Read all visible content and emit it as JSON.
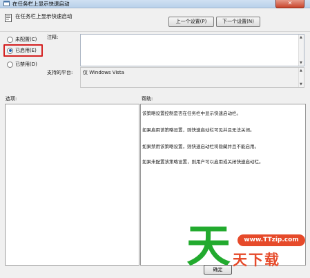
{
  "window": {
    "title": "在任务栏上显示快速启动"
  },
  "header": {
    "policy_name": "在任务栏上显示快速启动",
    "prev_label": "上一个设置(P)",
    "next_label": "下一个设置(N)"
  },
  "state": {
    "unconfigured": "未配置(C)",
    "enabled": "已启用(E)",
    "disabled": "已禁用(D)",
    "selected": "enabled"
  },
  "comment": {
    "label": "注释:",
    "value": ""
  },
  "supported": {
    "label": "支持的平台:",
    "value": "仅 Windows Vista"
  },
  "options": {
    "label": "选项:"
  },
  "help": {
    "label": "帮助:",
    "lines": [
      "该策略设置控制是否在任务栏中显示快速启动栏。",
      "如果启用该策略设置，则快速启动栏可见并且无法关闭。",
      "如果禁用该策略设置，则快速启动栏将隐藏并且不能启用。",
      "如果未配置该策略设置，则用户可以启用或关闭快速启动栏。"
    ]
  },
  "footer": {
    "ok_label": "确定"
  },
  "watermark": {
    "big": "天",
    "pill": "www.TTzip.com",
    "brand": "天下载"
  },
  "colors": {
    "highlight": "#d42020",
    "watermark_green": "#22aa2e",
    "watermark_red": "#e64a2a"
  },
  "icons": {
    "window": "policy-icon",
    "close": "close-icon"
  }
}
